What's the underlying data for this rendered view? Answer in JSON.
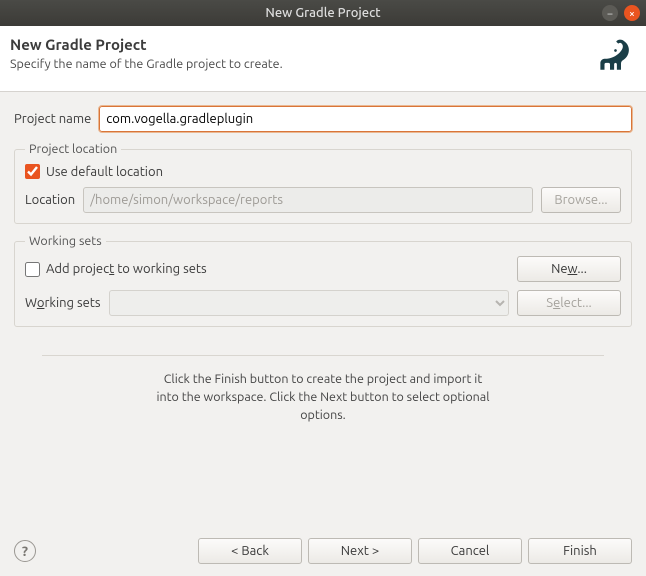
{
  "window": {
    "title": "New Gradle Project"
  },
  "header": {
    "title": "New Gradle Project",
    "subtitle": "Specify the name of the Gradle project to create."
  },
  "project_name": {
    "label": "Project name",
    "value": "com.vogella.gradleplugin"
  },
  "location_group": {
    "legend": "Project location",
    "use_default_label": "Use default location",
    "use_default_checked": true,
    "location_label": "Location",
    "location_value": "/home/simon/workspace/reports",
    "browse_label": "Browse..."
  },
  "working_sets_group": {
    "legend": "Working sets",
    "add_label_pre": "Add projec",
    "add_label_underline": "t",
    "add_label_post": " to working sets",
    "add_checked": false,
    "new_label_pre": "Ne",
    "new_label_underline": "w",
    "new_label_post": "...",
    "combo_label_pre": "W",
    "combo_label_underline": "o",
    "combo_label_post": "rking sets",
    "select_label_pre": "S",
    "select_label_underline": "e",
    "select_label_post": "lect..."
  },
  "hint": {
    "line1": "Click the Finish button to create the project and import it",
    "line2": "into the workspace. Click the Next button to select optional",
    "line3": "options."
  },
  "footer": {
    "back": "< Back",
    "next": "Next >",
    "cancel": "Cancel",
    "finish": "Finish"
  }
}
